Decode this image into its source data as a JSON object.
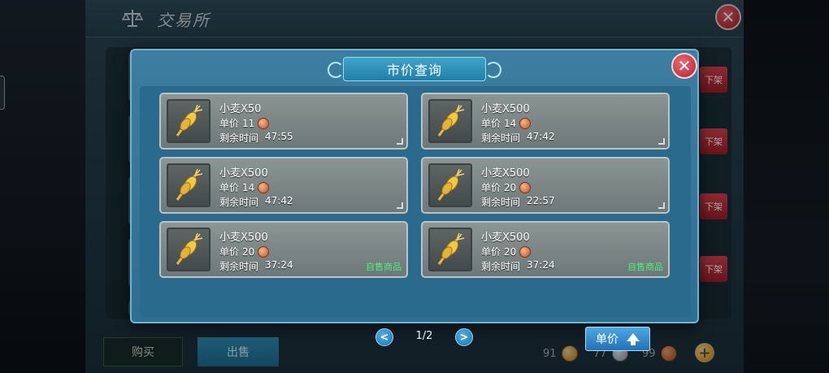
{
  "exchange": {
    "title": "交易所",
    "buy_tab": "购买",
    "sell_tab": "出售",
    "delist_label": "下架",
    "currencies": [
      {
        "amount": "91",
        "icon": "gold-coin-icon"
      },
      {
        "amount": "77",
        "icon": "silver-coin-icon"
      },
      {
        "amount": "99",
        "icon": "copper-coin-icon"
      }
    ],
    "add_icon": "plus-icon"
  },
  "modal": {
    "title": "市价查询",
    "price_label": "单价",
    "time_label": "剩余时间",
    "self_sale_label": "自售商品",
    "listings": [
      {
        "name": "小麦X50",
        "price": "11",
        "time": "47:55",
        "self": false
      },
      {
        "name": "小麦X500",
        "price": "14",
        "time": "47:42",
        "self": false
      },
      {
        "name": "小麦X500",
        "price": "14",
        "time": "47:42",
        "self": false
      },
      {
        "name": "小麦X500",
        "price": "20",
        "time": "22:57",
        "self": false
      },
      {
        "name": "小麦X500",
        "price": "20",
        "time": "37:24",
        "self": true
      },
      {
        "name": "小麦X500",
        "price": "20",
        "time": "37:24",
        "self": true
      }
    ],
    "pager": {
      "prev": "<",
      "next": ">",
      "page": "1/2"
    },
    "sort_button": {
      "label": "单价",
      "icon": "arrow-up-icon"
    }
  },
  "colors": {
    "modal_bg": "#2e6e92",
    "self_sale": "#4cf07c",
    "close_red": "#b0222e"
  }
}
